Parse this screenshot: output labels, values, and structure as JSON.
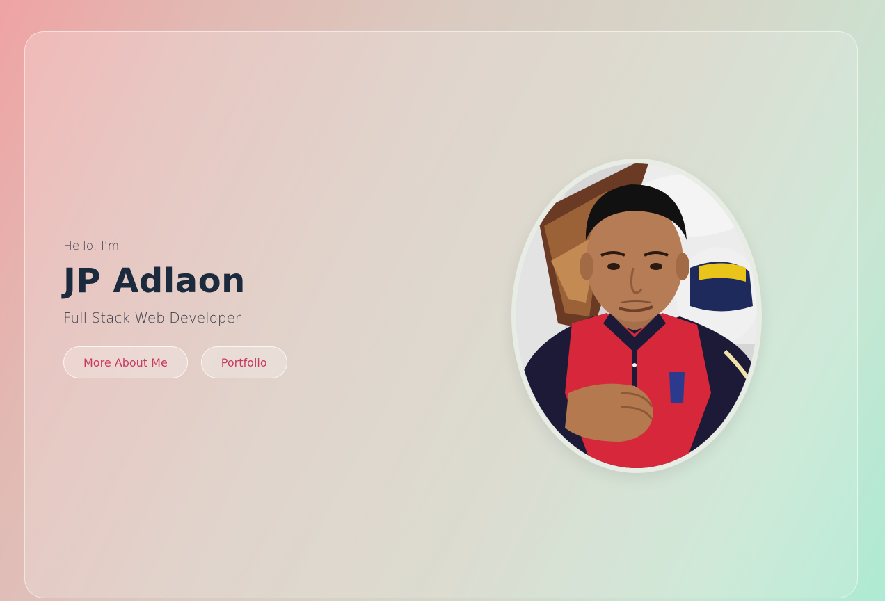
{
  "hero": {
    "greeting": "Hello, I'm",
    "name": "JP Adlaon",
    "role": "Full Stack Web Developer",
    "buttons": {
      "about": "More About Me",
      "portfolio": "Portfolio"
    }
  },
  "photo": {
    "alt": "Portrait photo"
  },
  "colors": {
    "accent": "#c83a62",
    "heading": "#1c2a3e",
    "text": "#3a3f4c"
  }
}
